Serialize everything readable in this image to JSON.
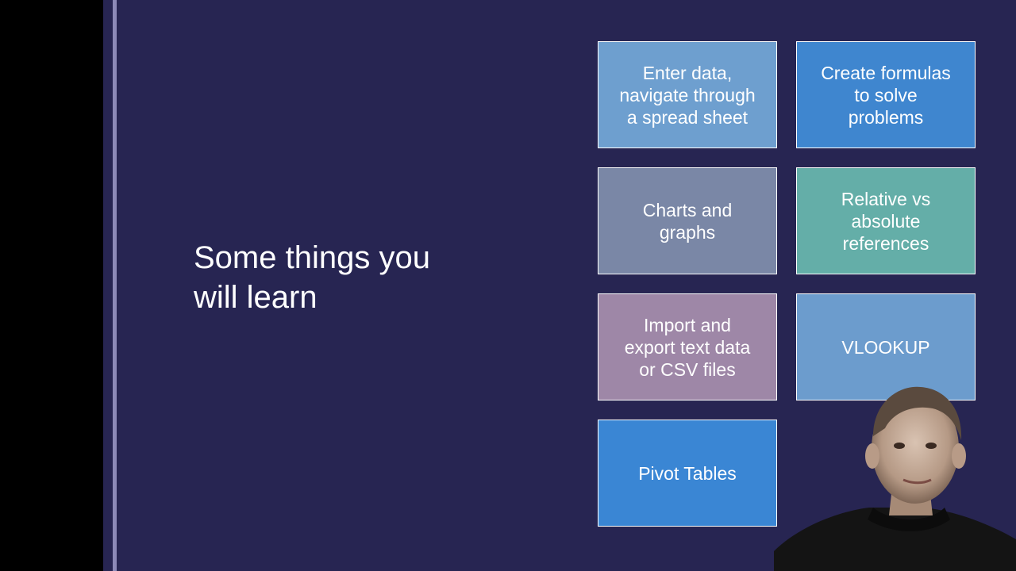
{
  "slide": {
    "title": "Some things you\nwill learn",
    "tiles": [
      {
        "label": "Enter data,\nnavigate through\na spread sheet",
        "color": "#6e9fcf"
      },
      {
        "label": "Create formulas\nto solve\nproblems",
        "color": "#3f86cf"
      },
      {
        "label": "Charts and\ngraphs",
        "color": "#7a87a6"
      },
      {
        "label": "Relative vs\nabsolute\nreferences",
        "color": "#64aea8"
      },
      {
        "label": "Import and\nexport text data\nor CSV files",
        "color": "#9e87a7"
      },
      {
        "label": "VLOOKUP",
        "color": "#6c9ccd"
      },
      {
        "label": "Pivot Tables",
        "color": "#3a86d4"
      }
    ]
  },
  "colors": {
    "background": "#272552",
    "accent_line": "#8d8ab8"
  }
}
